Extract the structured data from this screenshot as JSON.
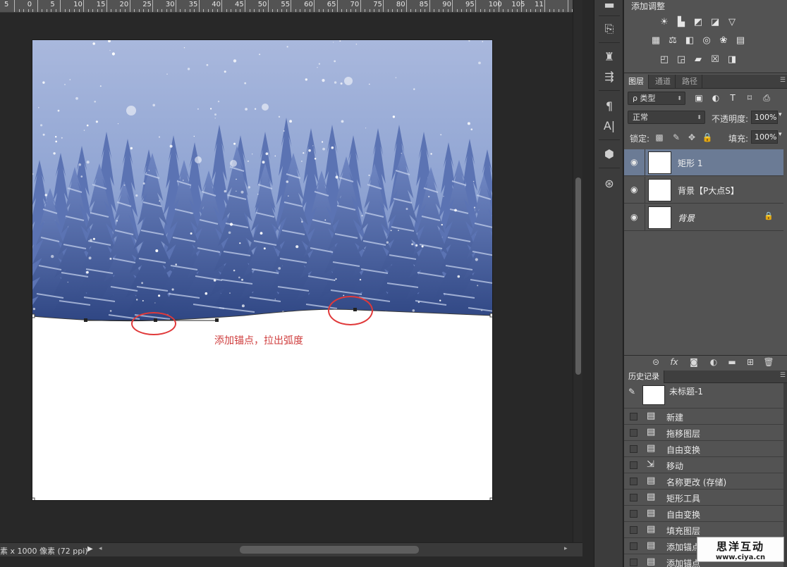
{
  "ruler": {
    "labels": [
      "5",
      "0",
      "5",
      "10",
      "15",
      "20",
      "25",
      "30",
      "35",
      "40",
      "45",
      "50",
      "55",
      "60",
      "65",
      "70",
      "75",
      "80",
      "85",
      "90",
      "95",
      "100",
      "105",
      "11"
    ]
  },
  "canvas": {
    "annotation": "添加锚点，拉出弧度",
    "colors": {
      "sky_top": "#a9b8dd",
      "sky_bottom": "#7f97cb",
      "tree_dark": "#2f4683",
      "tree_mid": "#5b73b3",
      "snow": "#ffffff",
      "annotation_red": "#e0393a",
      "path": "#2b2b2b"
    }
  },
  "status": {
    "text": "素 x 1000 像素 (72 ppi)",
    "arrow": "▶"
  },
  "adjustments": {
    "title": "添加调整",
    "icons": [
      "brightness-icon",
      "levels-icon",
      "curves-icon",
      "exposure-icon",
      "vibrance-icon",
      "hue-saturation-icon",
      "color-balance-icon",
      "black-white-icon",
      "photo-filter-icon",
      "channel-mixer-icon",
      "color-lookup-icon",
      "invert-icon",
      "posterize-icon",
      "threshold-icon",
      "gradient-map-icon",
      "selective-color-icon"
    ]
  },
  "layers": {
    "tabs": [
      "图层",
      "通道",
      "路径"
    ],
    "filter": "ρ 类型",
    "blend_mode": "正常",
    "opacity_label": "不透明度:",
    "opacity_value": "100%",
    "lock_label": "锁定:",
    "fill_label": "填充:",
    "fill_value": "100%",
    "items": [
      {
        "name": "矩形 1",
        "selected": true,
        "italic": false,
        "locked": false
      },
      {
        "name": "背景【P大点S】",
        "selected": false,
        "italic": false,
        "locked": false
      },
      {
        "name": "背景",
        "selected": false,
        "italic": true,
        "locked": true
      }
    ]
  },
  "history": {
    "tab": "历史记录",
    "snapshot_name": "未标题-1",
    "items": [
      "新建",
      "拖移图层",
      "自由变换",
      "移动",
      "名称更改 (存储)",
      "矩形工具",
      "自由变换",
      "填充图层",
      "添加锚点",
      "添加锚点"
    ]
  },
  "watermark": {
    "line1": "思洋互动",
    "line2": "www.ciya.cn"
  }
}
